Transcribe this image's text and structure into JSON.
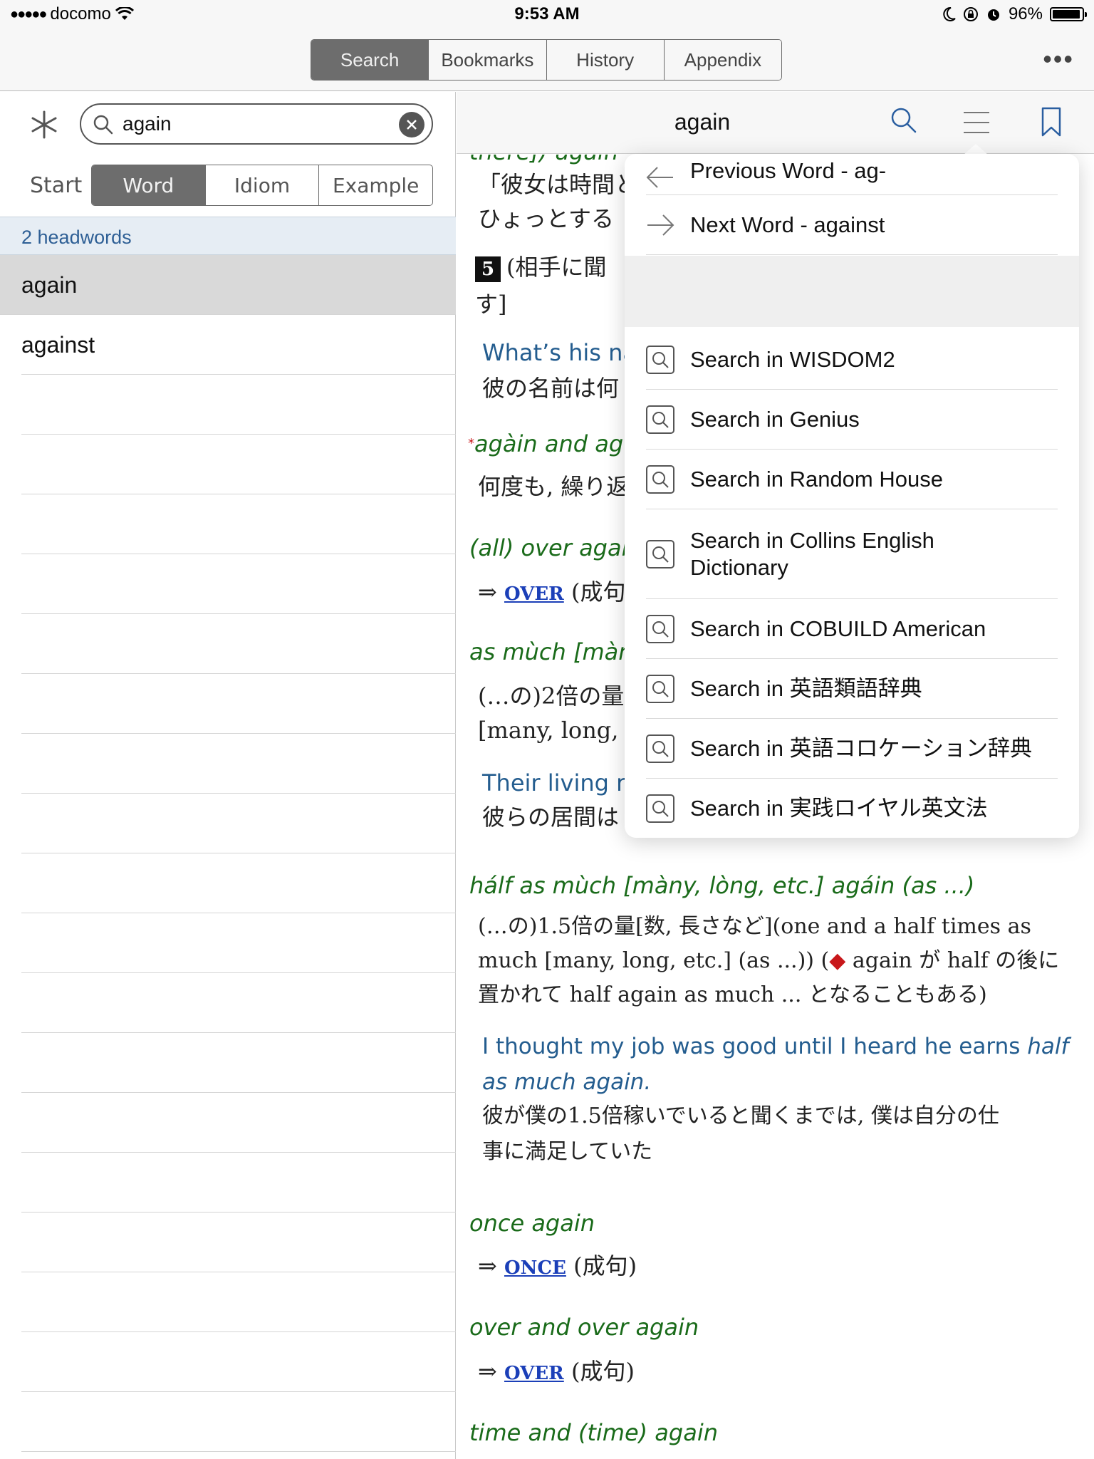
{
  "status_bar": {
    "signal": "●●●●●",
    "carrier": "docomo",
    "time": "9:53 AM",
    "battery": "96%"
  },
  "top_nav": {
    "tabs": [
      "Search",
      "Bookmarks",
      "History",
      "Appendix"
    ],
    "active_tab": "Search",
    "more": "•••"
  },
  "search": {
    "query": "again"
  },
  "modes": {
    "start_label": "Start",
    "items": [
      "Word",
      "Idiom",
      "Example"
    ],
    "active": "Word"
  },
  "results": {
    "count_label": "2 headwords",
    "items": [
      "again",
      "against"
    ]
  },
  "entry": {
    "title": "again",
    "lines": {
      "l1": "there]) again",
      "l2": "「彼女は時間と",
      "l3": "ひょっとする",
      "l4_num": "5",
      "l4": "(相手に聞",
      "l5": "す]",
      "l6": "What’s his na",
      "l7": "彼の名前は何",
      "l8_star": "*",
      "l8": "agàin and ag",
      "l9": "何度も, 繰り返",
      "l10": "(all) over agai",
      "l11_arrow": "⇒",
      "l11_link": "OVER",
      "l11": "(成句)",
      "l12": "as mùch [màn",
      "l13": "(…の)2倍の量",
      "l14": "[many, long, e",
      "l15": "Their living ro",
      "l16": "彼らの居間は",
      "l17": "hálf as mùch [màny, lòng, etc.] agáin (as ...)",
      "l18": "(…の)1.5倍の量[数, 長さなど](one and a half times as",
      "l19a": "much [many, long, etc.] (as ...)) (",
      "l19_diamond": "◆",
      "l19b": " again が half の後に",
      "l20": "置かれて half again as much ... となることもある)",
      "l21a": "I thought my job was good until I heard he earns ",
      "l21b": "half",
      "l22": "as much again.",
      "l23": "彼が僕の1.5倍稼いでいると聞くまでは, 僕は自分の仕",
      "l24": "事に満足していた",
      "l25": "once again",
      "l26_arrow": "⇒",
      "l26_link": "ONCE",
      "l26": "(成句)",
      "l27": "over and over again",
      "l28_arrow": "⇒",
      "l28_link": "OVER",
      "l28": "(成句)",
      "l29": "time and (time) again"
    }
  },
  "popup_menu": {
    "previous_word": "Previous Word - ag-",
    "next_word": "Next Word - against",
    "search_items": [
      "Search in WISDOM2",
      "Search in Genius",
      "Search in Random House",
      "Search in Collins English Dictionary",
      "Search in COBUILD American",
      "Search in 英語類語辞典",
      "Search in 英語コロケーション辞典",
      "Search in 実践ロイヤル英文法"
    ]
  },
  "colors": {
    "idiom": "#1a6b1a",
    "example": "#245d8f",
    "link": "#1b3fb8",
    "active_segment": "#6d6d6d",
    "headword_bar": "#e6edf4"
  }
}
